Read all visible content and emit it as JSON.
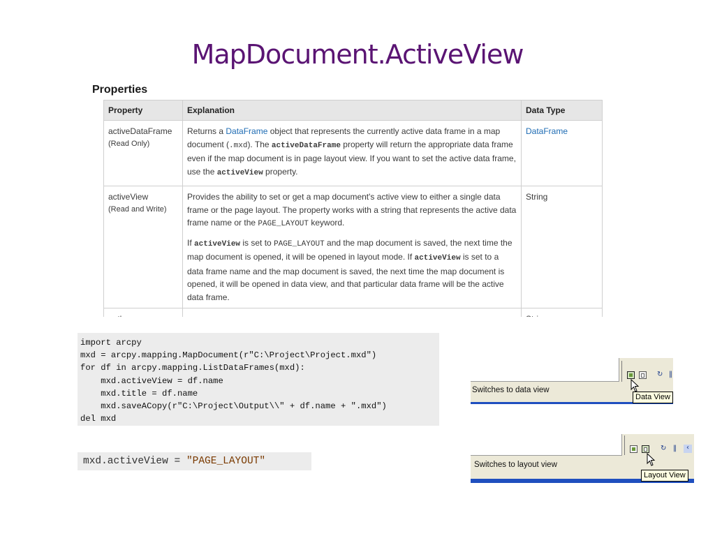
{
  "title": "MapDocument.ActiveView",
  "properties": {
    "heading": "Properties",
    "columns": [
      "Property",
      "Explanation",
      "Data Type"
    ],
    "rows": [
      {
        "name": "activeDataFrame",
        "access": "(Read Only)",
        "exp": {
          "t1": "Returns a ",
          "link": "DataFrame",
          "t2": " object that represents the currently active data frame in a map document (",
          "c1": ".mxd",
          "t3": "). The ",
          "b1": "activeDataFrame",
          "t4": " property will return the appropriate data frame even if the map document is in page layout view. If you want to set the active data frame, use the ",
          "b2": "activeView",
          "t5": " property."
        },
        "type": "DataFrame"
      },
      {
        "name": "activeView",
        "access": "(Read and Write)",
        "exp1": {
          "t1": "Provides the ability to set or get a map document's active view to either a single data frame or the page layout. The property works with a string that represents the active data frame name or the ",
          "c1": "PAGE_LAYOUT",
          "t2": " keyword."
        },
        "exp2": {
          "t1": "If ",
          "b1": "activeView",
          "t2": " is set to ",
          "c1": "PAGE_LAYOUT",
          "t3": " and the map document is saved, the next time the map document is opened, it will be opened in layout mode. If ",
          "b2": "activeView",
          "t4": " is set to a data frame name and the map document is saved, the next time the map document is opened, it will be opened in data view, and that particular data frame will be the active data frame."
        },
        "type": "String"
      },
      {
        "name": "author",
        "type": "String"
      }
    ]
  },
  "code": {
    "lines": [
      "import arcpy",
      "mxd = arcpy.mapping.MapDocument(r\"C:\\Project\\Project.mxd\")",
      "for df in arcpy.mapping.ListDataFrames(mxd):",
      "    mxd.activeView = df.name",
      "    mxd.title = df.name",
      "    mxd.saveACopy(r\"C:\\Project\\Output\\\\\" + df.name + \".mxd\")",
      "del mxd"
    ],
    "snippet_prefix": "mxd.activeView = ",
    "snippet_string": "\"PAGE_LAYOUT\""
  },
  "screenshots": {
    "data_view": {
      "status": "Switches to data view",
      "tooltip": "Data View"
    },
    "layout_view": {
      "status": "Switches to layout view",
      "tooltip": "Layout View"
    }
  },
  "colors": {
    "title": "#5a1473",
    "link": "#1d6bb3",
    "statusbar": "#1f4fbf"
  }
}
